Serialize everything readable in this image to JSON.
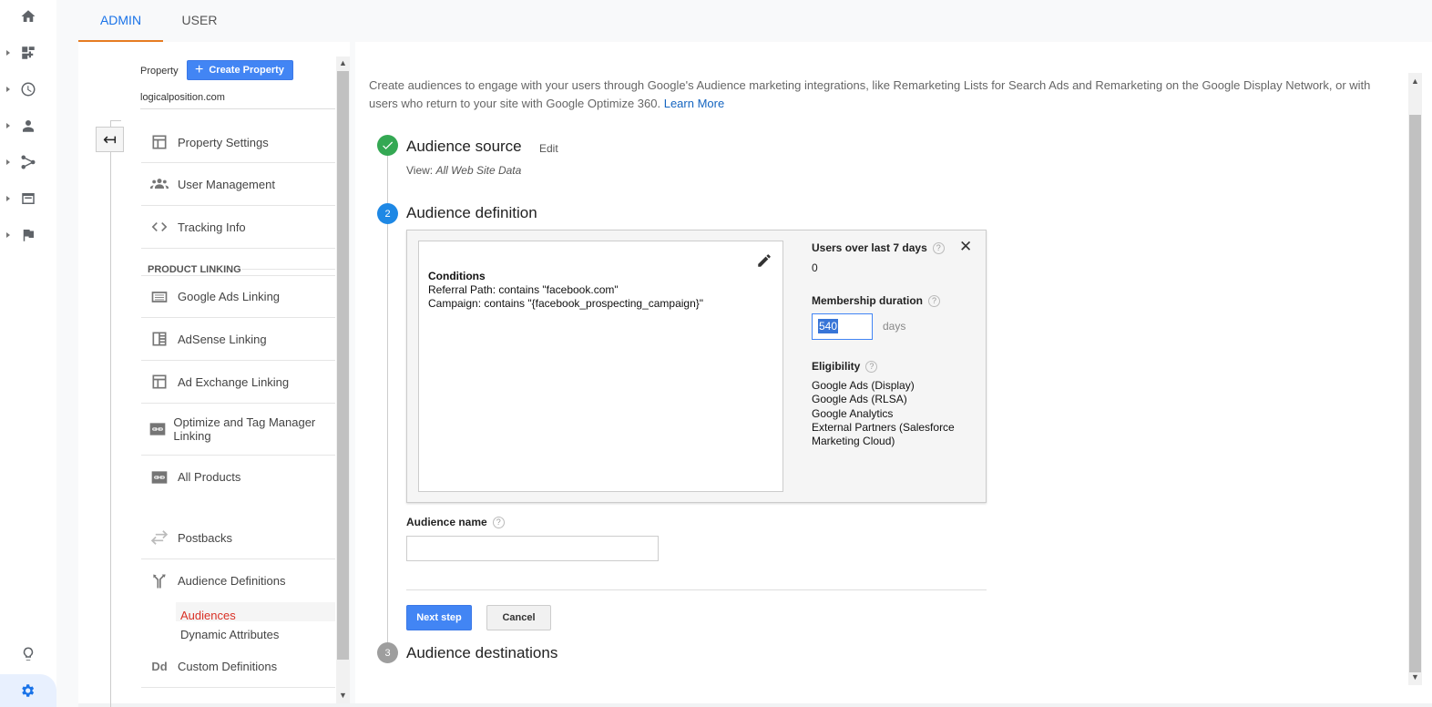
{
  "tabs": [
    {
      "label": "ADMIN",
      "active": true
    },
    {
      "label": "USER",
      "active": false
    }
  ],
  "rail_icons": [
    "home-icon",
    "dashboard-icon",
    "clock-icon",
    "person-icon",
    "acquisition-icon",
    "behavior-icon",
    "flag-icon",
    "lightbulb-icon",
    "gear-icon"
  ],
  "property": {
    "label": "Property",
    "create_label": "Create Property",
    "account": "logicalposition.com"
  },
  "nav": {
    "property_settings": "Property Settings",
    "user_management": "User Management",
    "tracking_info": "Tracking Info",
    "section_product_linking": "PRODUCT LINKING",
    "google_ads_linking": "Google Ads Linking",
    "adsense_linking": "AdSense Linking",
    "ad_exchange_linking": "Ad Exchange Linking",
    "optimize_tag_manager_linking": "Optimize and Tag Manager Linking",
    "all_products": "All Products",
    "postbacks": "Postbacks",
    "audience_definitions": "Audience Definitions",
    "audiences": "Audiences",
    "dynamic_attributes": "Dynamic Attributes",
    "custom_definitions": "Custom Definitions",
    "custom_definitions_icon_text": "Dd"
  },
  "main": {
    "intro_text": "Create audiences to engage with your users through Google's Audience marketing integrations, like Remarketing Lists for Search Ads and Remarketing on the Google Display Network, or with users who return to your site with Google Optimize 360.",
    "learn_more": "Learn More",
    "step1": {
      "title": "Audience source",
      "edit": "Edit",
      "view_label": "View:",
      "view_value": "All Web Site Data"
    },
    "step2": {
      "number": "2",
      "title": "Audience definition",
      "conditions_title": "Conditions",
      "conditions": [
        "Referral Path: contains \"facebook.com\"",
        "Campaign: contains \"{facebook_prospecting_campaign}\""
      ],
      "users_label": "Users over last 7 days",
      "users_value": "0",
      "membership_label": "Membership duration",
      "membership_value": "540",
      "days_label": "days",
      "eligibility_label": "Eligibility",
      "eligibility": [
        "Google Ads (Display)",
        "Google Ads (RLSA)",
        "Google Analytics",
        "External Partners (Salesforce Marketing Cloud)"
      ],
      "help_glyph": "?",
      "close_glyph": "✕"
    },
    "audience_name_label": "Audience name",
    "audience_name_value": "",
    "next_step": "Next step",
    "cancel": "Cancel",
    "step3": {
      "number": "3",
      "title": "Audience destinations"
    }
  },
  "colors": {
    "accent": "#1a73e8",
    "tab_underline": "#e67c22",
    "button_blue": "#4285f4",
    "success_green": "#34a853",
    "active_link_red": "#d93025",
    "step_active_blue": "#1e88e5",
    "step_inactive_gray": "#9e9e9e"
  }
}
